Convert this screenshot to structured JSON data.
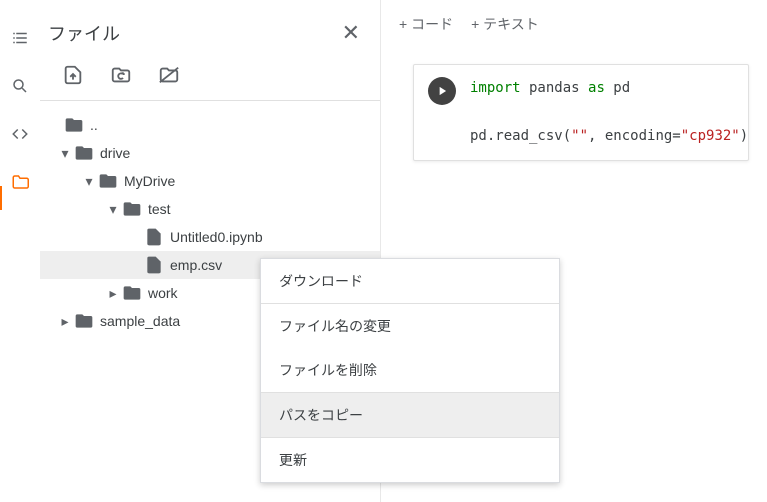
{
  "panel": {
    "title": "ファイル"
  },
  "tree": {
    "parent": "..",
    "drive": "drive",
    "mydrive": "MyDrive",
    "test": "test",
    "untitled": "Untitled0.ipynb",
    "emp": "emp.csv",
    "work": "work",
    "sample": "sample_data"
  },
  "topbar": {
    "code": "+ コード",
    "text": "+ テキスト"
  },
  "code": {
    "kw_import": "import",
    "pandas": " pandas ",
    "kw_as": "as",
    "pd": " pd",
    "line2a": "pd.read_csv(",
    "str1": "\"\"",
    "enc": ", encoding=",
    "str2": "\"cp932\"",
    "close": ")"
  },
  "menu": {
    "download": "ダウンロード",
    "rename": "ファイル名の変更",
    "delete": "ファイルを削除",
    "copypath": "パスをコピー",
    "refresh": "更新"
  }
}
